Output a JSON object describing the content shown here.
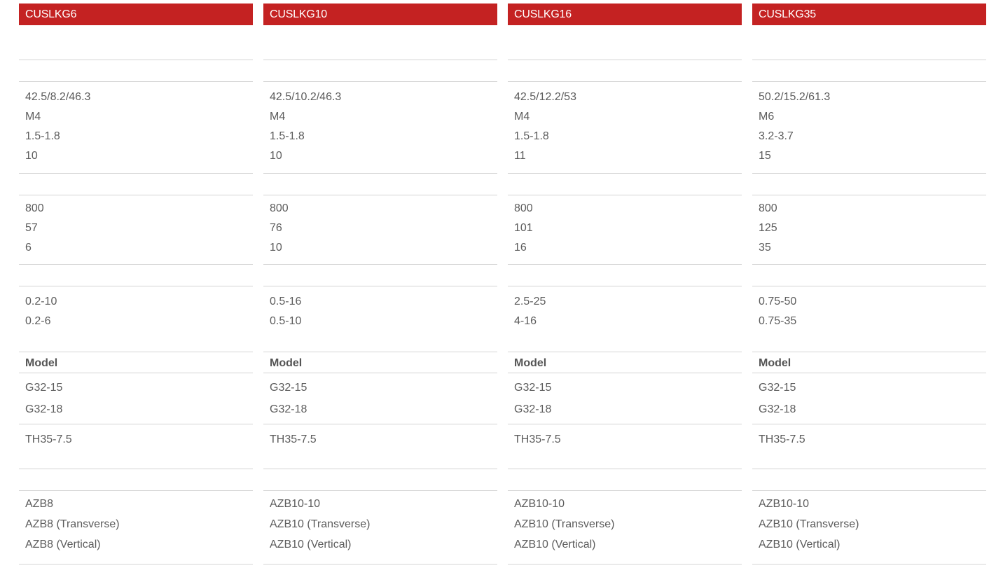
{
  "columns": [
    {
      "header": "CUSLKG6",
      "dimensions": "42.5/8.2/46.3",
      "screw": "M4",
      "torque": "1.5-1.8",
      "strip": "10",
      "voltage": "800",
      "current": "57",
      "cross_section": "6",
      "range_1": "0.2-10",
      "range_2": "0.2-6",
      "model_label": "Model",
      "rail_1": "G32-15",
      "rail_2": "G32-18",
      "rail_3": "TH35-7.5",
      "acc_1": "AZB8",
      "acc_2": "AZB8 (Transverse)",
      "acc_3": "AZB8 (Vertical)"
    },
    {
      "header": "CUSLKG10",
      "dimensions": "42.5/10.2/46.3",
      "screw": "M4",
      "torque": "1.5-1.8",
      "strip": "10",
      "voltage": "800",
      "current": "76",
      "cross_section": "10",
      "range_1": "0.5-16",
      "range_2": "0.5-10",
      "model_label": "Model",
      "rail_1": "G32-15",
      "rail_2": "G32-18",
      "rail_3": "TH35-7.5",
      "acc_1": "AZB10-10",
      "acc_2": "AZB10 (Transverse)",
      "acc_3": "AZB10 (Vertical)"
    },
    {
      "header": "CUSLKG16",
      "dimensions": "42.5/12.2/53",
      "screw": "M4",
      "torque": "1.5-1.8",
      "strip": "11",
      "voltage": "800",
      "current": "101",
      "cross_section": "16",
      "range_1": "2.5-25",
      "range_2": "4-16",
      "model_label": "Model",
      "rail_1": "G32-15",
      "rail_2": "G32-18",
      "rail_3": "TH35-7.5",
      "acc_1": "AZB10-10",
      "acc_2": "AZB10 (Transverse)",
      "acc_3": "AZB10 (Vertical)"
    },
    {
      "header": "CUSLKG35",
      "dimensions": "50.2/15.2/61.3",
      "screw": "M6",
      "torque": "3.2-3.7",
      "strip": "15",
      "voltage": "800",
      "current": "125",
      "cross_section": "35",
      "range_1": "0.75-50",
      "range_2": "0.75-35",
      "model_label": "Model",
      "rail_1": "G32-15",
      "rail_2": "G32-18",
      "rail_3": "TH35-7.5",
      "acc_1": "AZB10-10",
      "acc_2": "AZB10 (Transverse)",
      "acc_3": "AZB10 (Vertical)"
    }
  ]
}
